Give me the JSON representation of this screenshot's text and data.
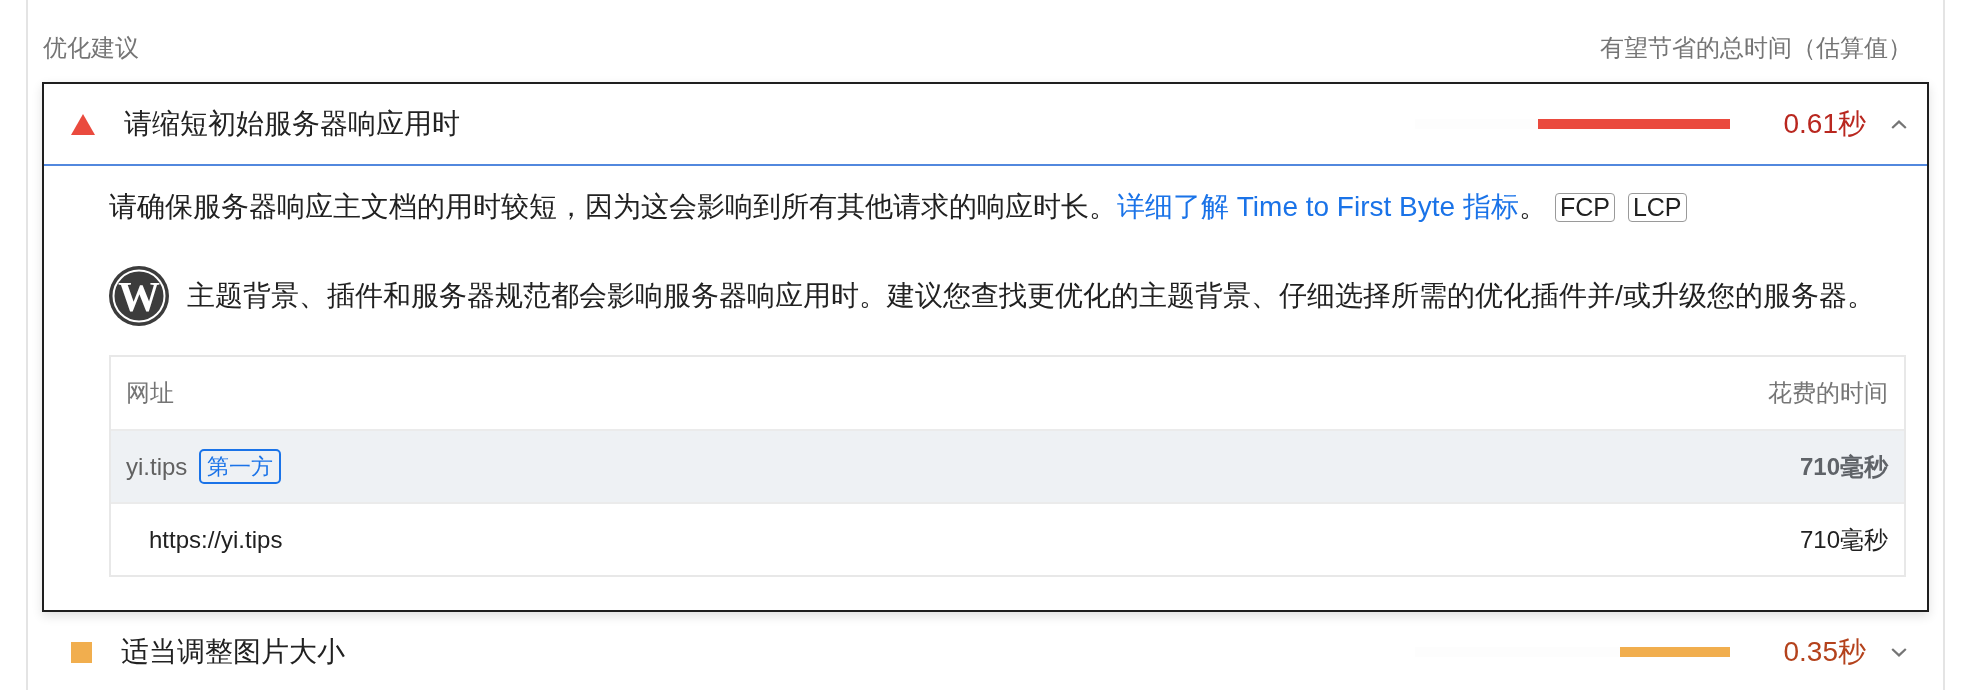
{
  "section_header": {
    "title": "优化建议",
    "savings_label": "有望节省的总时间（估算值）"
  },
  "audits": [
    {
      "kind": "fail",
      "title": "请缩短初始服务器响应用时",
      "level": 0.61,
      "savings": "0.61秒",
      "expanded": true,
      "description": {
        "text": "请确保服务器响应主文档的用时较短，因为这会影响到所有其他请求的响应时长。",
        "link": "详细了解 Time to First Byte 指标",
        "text_after": "。"
      },
      "tags": [
        "FCP",
        "LCP"
      ],
      "stack_note": {
        "logo_letter": "W",
        "text": "主题背景、插件和服务器规范都会影响服务器响应用时。建议您查找更优化的主题背景、仔细选择所需的优化插件并/或升级您的服务器。"
      },
      "table": {
        "columns": [
          "网址",
          "花费的时间"
        ],
        "rows": [
          {
            "kind": "entity",
            "url": "yi.tips",
            "badge": "第一方",
            "time": "710毫秒"
          },
          {
            "kind": "resource",
            "url": "https://yi.tips",
            "time": "710毫秒"
          }
        ]
      }
    },
    {
      "kind": "average",
      "title": "适当调整图片大小",
      "level": 0.35,
      "savings": "0.35秒",
      "expanded": false
    }
  ]
}
